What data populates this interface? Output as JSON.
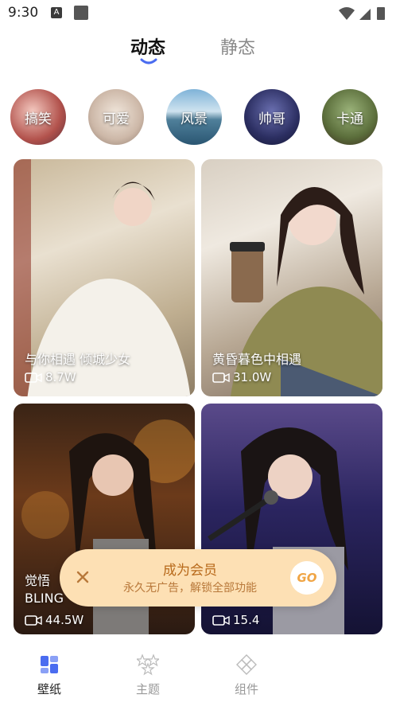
{
  "status": {
    "time": "9:30",
    "a_badge": "A"
  },
  "tabs": [
    {
      "label": "动态",
      "active": true
    },
    {
      "label": "静态",
      "active": false
    }
  ],
  "categories": [
    {
      "label": "搞笑"
    },
    {
      "label": "可爱"
    },
    {
      "label": "风景"
    },
    {
      "label": "帅哥"
    },
    {
      "label": "卡通"
    }
  ],
  "cards": [
    {
      "title": "与你相遇 倾城少女",
      "views": "8.7W"
    },
    {
      "title": "黄昏暮色中相遇",
      "views": "31.0W"
    },
    {
      "title": "觉悟\nBLING",
      "views": "44.5W"
    },
    {
      "title": "",
      "views": "15.4"
    }
  ],
  "vip": {
    "title": "成为会员",
    "subtitle": "永久无广告，解锁全部功能",
    "go": "GO"
  },
  "nav": [
    {
      "label": "壁纸",
      "icon": "wallpaper-icon"
    },
    {
      "label": "主题",
      "icon": "theme-icon"
    },
    {
      "label": "组件",
      "icon": "widget-icon"
    }
  ],
  "colors": {
    "accent": "#4a6cf0",
    "vip_bg": "#fde0b4",
    "vip_text": "#b86a1c"
  }
}
